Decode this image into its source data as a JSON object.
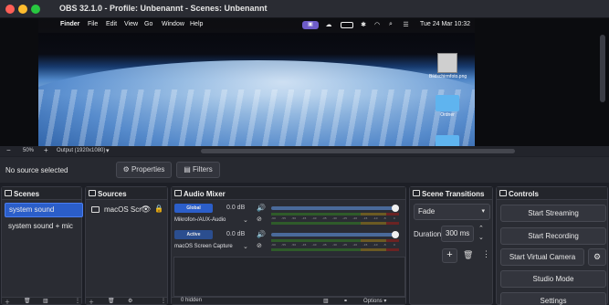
{
  "window": {
    "title": "OBS 32.1.0 - Profile: Unbenannt - Scenes: Unbenannt"
  },
  "mac_menubar": {
    "apple": "",
    "app": "Finder",
    "items": [
      "File",
      "Edit",
      "View",
      "Go",
      "Window",
      "Help"
    ],
    "datetime": "Tue 24 Mar  10:32"
  },
  "desktop": {
    "file_label": "Bildschirmfoto.png",
    "folder1_label": "Ordner",
    "folder2_label": ""
  },
  "preview_toolbar": {
    "minus": "−",
    "zoom": "50%",
    "plus": "+",
    "output": "Output (1920x1080)",
    "chevron": "▾"
  },
  "source_bar": {
    "no_source": "No source selected",
    "properties": "⚙ Properties",
    "filters": "▤ Filters"
  },
  "scenes": {
    "title": "Scenes",
    "items": [
      "system sound",
      "system sound + mic"
    ],
    "active_index": 0
  },
  "sources": {
    "title": "Sources",
    "items": [
      {
        "name": "macOS Scr",
        "visible_icon": "eye-icon",
        "lock_icon": "lock-icon"
      }
    ]
  },
  "mixer": {
    "title": "Audio Mixer",
    "channels": [
      {
        "badge": "Global",
        "name": "Mikrofon-/AUX-Audio",
        "db": "0.0 dB",
        "volume": 1.0
      },
      {
        "badge": "Active",
        "name": "macOS Screen Capture",
        "db": "0.0 dB",
        "volume": 1.0
      }
    ],
    "meter_ticks": [
      "-60",
      "-55",
      "-50",
      "-45",
      "-40",
      "-35",
      "-30",
      "-25",
      "-20",
      "-15",
      "-10",
      "-5",
      "0"
    ],
    "hidden_count": "0 hidden"
  },
  "transitions": {
    "title": "Scene Transitions",
    "selected": "Fade",
    "duration_label": "Duration",
    "duration_value": "300 ms"
  },
  "controls": {
    "title": "Controls",
    "start_streaming": "Start Streaming",
    "start_recording": "Start Recording",
    "start_virtual_camera": "Start Virtual Camera",
    "studio_mode": "Studio Mode",
    "settings": "Settings"
  },
  "colors": {
    "accent": "#2b5ec9",
    "background": "#1d1f26",
    "dock": "#2a2c33"
  }
}
